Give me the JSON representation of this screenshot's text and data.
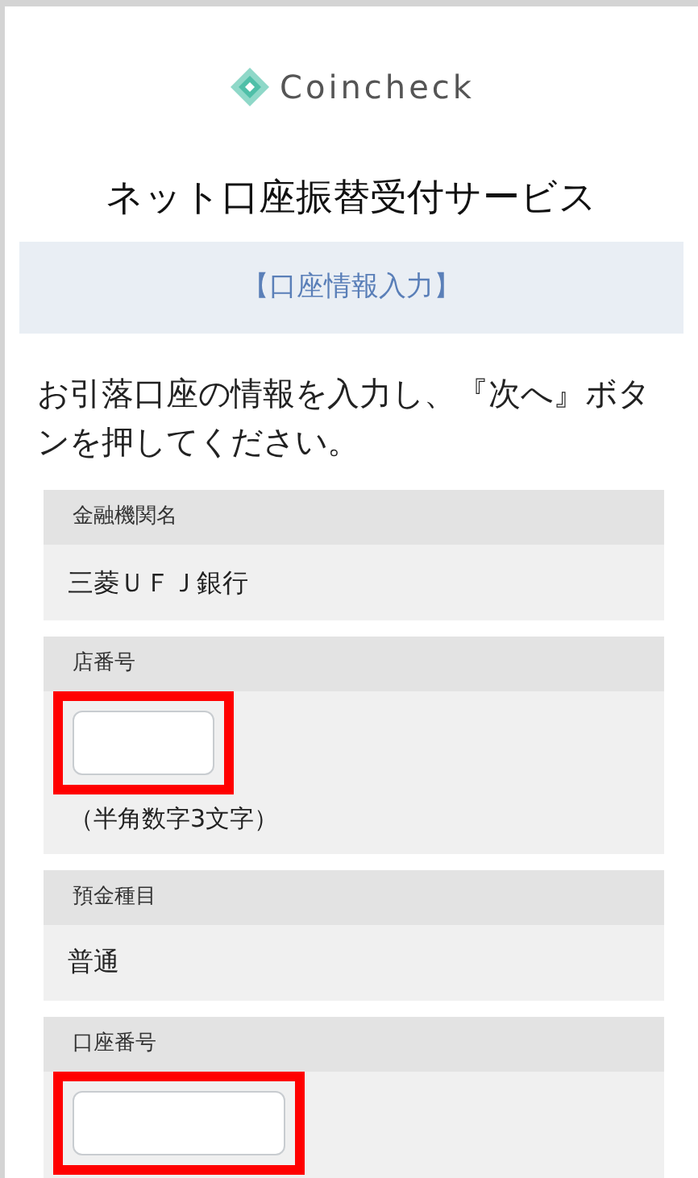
{
  "logo": {
    "text": "Coincheck"
  },
  "title": "ネット口座振替受付サービス",
  "banner": "【口座情報入力】",
  "instruction": "お引落口座の情報を入力し、『次へ』ボタンを押してください。",
  "fields": [
    {
      "kind": "text",
      "label": "金融機関名",
      "value": "三菱ＵＦＪ銀行"
    },
    {
      "kind": "input",
      "label": "店番号",
      "highlighted": true,
      "wide": false,
      "hint": "（半角数字3文字）"
    },
    {
      "kind": "text",
      "label": "預金種目",
      "value": "普通"
    },
    {
      "kind": "input",
      "label": "口座番号",
      "highlighted": true,
      "wide": true
    }
  ]
}
